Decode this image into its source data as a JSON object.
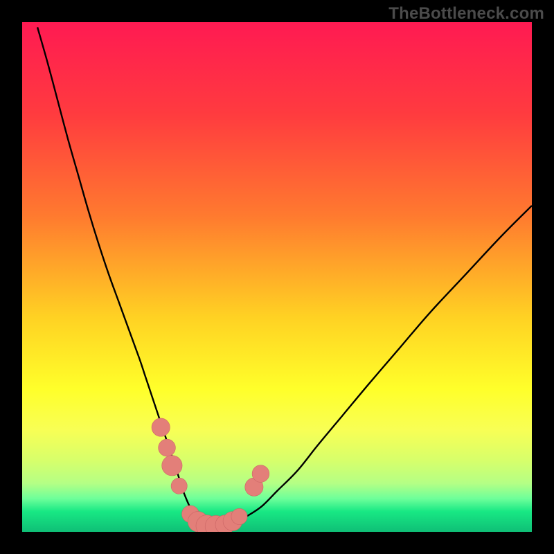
{
  "watermark": "TheBottleneck.com",
  "colors": {
    "frame": "#000000",
    "curve": "#000000",
    "marker_fill": "#e37f79",
    "marker_stroke": "#c66",
    "gradient_stops": [
      {
        "offset": 0.0,
        "color": "#ff1a52"
      },
      {
        "offset": 0.18,
        "color": "#ff3b3f"
      },
      {
        "offset": 0.38,
        "color": "#ff7a2f"
      },
      {
        "offset": 0.58,
        "color": "#ffd223"
      },
      {
        "offset": 0.72,
        "color": "#ffff2a"
      },
      {
        "offset": 0.8,
        "color": "#f8ff55"
      },
      {
        "offset": 0.86,
        "color": "#d7ff6b"
      },
      {
        "offset": 0.905,
        "color": "#b4ff85"
      },
      {
        "offset": 0.935,
        "color": "#6dff9a"
      },
      {
        "offset": 0.96,
        "color": "#18e884"
      },
      {
        "offset": 1.0,
        "color": "#0fbf76"
      }
    ]
  },
  "chart_data": {
    "type": "line",
    "title": "",
    "xlabel": "",
    "ylabel": "",
    "xlim": [
      0,
      100
    ],
    "ylim": [
      0,
      100
    ],
    "x": [
      3,
      5,
      7,
      9,
      11,
      13,
      15,
      17,
      19,
      21,
      23,
      24,
      25,
      26,
      27,
      28,
      29,
      30,
      30.8,
      31.6,
      32.4,
      33.2,
      34,
      35,
      36,
      37,
      38.5,
      40,
      42,
      44,
      47,
      50,
      54,
      58,
      63,
      68,
      74,
      80,
      87,
      94,
      100
    ],
    "series": [
      {
        "name": "bottleneck-curve",
        "values": [
          99,
          92,
          84.5,
          77,
          70,
          63,
          56.5,
          50.5,
          45,
          39.5,
          34,
          31,
          28,
          25,
          22,
          19,
          16,
          13,
          10.5,
          8,
          6,
          4.3,
          3,
          2,
          1.3,
          1,
          1,
          1.2,
          1.8,
          3,
          5,
          8,
          12,
          17,
          23,
          29,
          36,
          43,
          50.5,
          58,
          64
        ]
      }
    ],
    "markers": [
      {
        "x": 27.2,
        "y": 20.5,
        "r": 1.7
      },
      {
        "x": 28.4,
        "y": 16.5,
        "r": 1.6
      },
      {
        "x": 29.4,
        "y": 13.0,
        "r": 1.9
      },
      {
        "x": 30.8,
        "y": 9.0,
        "r": 1.5
      },
      {
        "x": 33.0,
        "y": 3.5,
        "r": 1.6
      },
      {
        "x": 34.5,
        "y": 2.0,
        "r": 1.9
      },
      {
        "x": 36.2,
        "y": 1.2,
        "r": 2.0
      },
      {
        "x": 38.0,
        "y": 1.1,
        "r": 2.0
      },
      {
        "x": 39.8,
        "y": 1.4,
        "r": 1.8
      },
      {
        "x": 41.3,
        "y": 2.1,
        "r": 1.8
      },
      {
        "x": 42.6,
        "y": 3.0,
        "r": 1.5
      },
      {
        "x": 45.5,
        "y": 8.8,
        "r": 1.7
      },
      {
        "x": 46.8,
        "y": 11.4,
        "r": 1.6
      }
    ]
  }
}
